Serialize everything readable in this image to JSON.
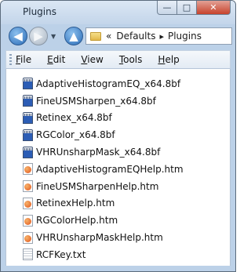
{
  "window": {
    "title": "Plugins",
    "controls": {
      "minimize": "—",
      "maximize": "□",
      "close": "✕"
    }
  },
  "nav": {
    "back_icon": "back-arrow-icon",
    "forward_icon": "forward-arrow-icon",
    "up_icon": "up-arrow-icon",
    "back_glyph": "◀",
    "forward_glyph": "▶",
    "dropdown_glyph": "▼",
    "up_glyph": "▲",
    "address": {
      "lead": "«",
      "crumbs": [
        "Defaults",
        "Plugins"
      ],
      "separator": "▸"
    }
  },
  "menu": {
    "items": [
      {
        "accel": "F",
        "rest": "ile"
      },
      {
        "accel": "E",
        "rest": "dit"
      },
      {
        "accel": "V",
        "rest": "iew"
      },
      {
        "accel": "T",
        "rest": "ools"
      },
      {
        "accel": "H",
        "rest": "elp"
      }
    ]
  },
  "files": [
    {
      "name": "AdaptiveHistogramEQ_x64.8bf",
      "icon": "plugin-file-icon"
    },
    {
      "name": "FineUSMSharpen_x64.8bf",
      "icon": "plugin-file-icon"
    },
    {
      "name": "Retinex_x64.8bf",
      "icon": "plugin-file-icon"
    },
    {
      "name": "RGColor_x64.8bf",
      "icon": "plugin-file-icon"
    },
    {
      "name": "VHRUnsharpMask_x64.8bf",
      "icon": "plugin-file-icon"
    },
    {
      "name": "AdaptiveHistogramEQHelp.htm",
      "icon": "html-file-icon"
    },
    {
      "name": "FineUSMSharpenHelp.htm",
      "icon": "html-file-icon"
    },
    {
      "name": "RetinexHelp.htm",
      "icon": "html-file-icon"
    },
    {
      "name": "RGColorHelp.htm",
      "icon": "html-file-icon"
    },
    {
      "name": "VHRUnsharpMaskHelp.htm",
      "icon": "html-file-icon"
    },
    {
      "name": "RCFKey.txt",
      "icon": "text-file-icon"
    }
  ]
}
